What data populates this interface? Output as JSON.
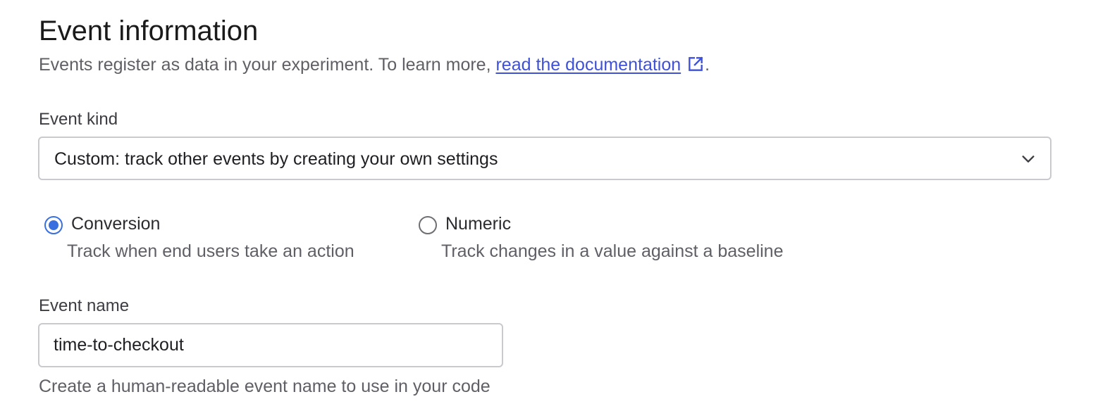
{
  "section": {
    "title": "Event information",
    "description_prefix": "Events register as data in your experiment. To learn more, ",
    "doc_link_text": "read the documentation",
    "description_suffix": "."
  },
  "event_kind": {
    "label": "Event kind",
    "selected_value": "Custom: track other events by creating your own settings"
  },
  "measurement": {
    "options": [
      {
        "label": "Conversion",
        "hint": "Track when end users take an action",
        "checked": true
      },
      {
        "label": "Numeric",
        "hint": "Track changes in a value against a baseline",
        "checked": false
      }
    ]
  },
  "event_name": {
    "label": "Event name",
    "value": "time-to-checkout",
    "help": "Create a human-readable event name to use in your code"
  },
  "colors": {
    "accent": "#3a6fe0",
    "link": "#3f51d6",
    "border": "#c9c9ce",
    "muted_text": "#5f5f66"
  },
  "icons": {
    "external_link": "external-link-icon",
    "dropdown": "chevron-down-icon"
  }
}
